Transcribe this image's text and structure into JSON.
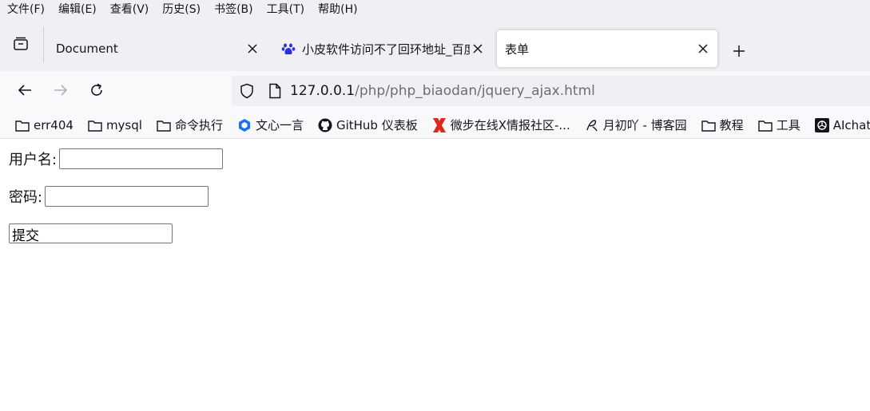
{
  "menubar": {
    "items": [
      {
        "label": "文件(F)"
      },
      {
        "label": "编辑(E)"
      },
      {
        "label": "查看(V)"
      },
      {
        "label": "历史(S)"
      },
      {
        "label": "书签(B)"
      },
      {
        "label": "工具(T)"
      },
      {
        "label": "帮助(H)"
      }
    ]
  },
  "tabs": [
    {
      "title": "Document",
      "favicon": "none",
      "active": false
    },
    {
      "title": "小皮软件访问不了回环地址_百度",
      "favicon": "baidu-paw-icon",
      "active": false
    },
    {
      "title": "表单",
      "favicon": "none",
      "active": true
    }
  ],
  "navbar": {
    "url_host": "127.0.0.1",
    "url_path": "/php/php_biaodan/jquery_ajax.html"
  },
  "bookmarks": [
    {
      "label": "err404",
      "icon": "folder-icon"
    },
    {
      "label": "mysql",
      "icon": "folder-icon"
    },
    {
      "label": "命令执行",
      "icon": "folder-icon"
    },
    {
      "label": "文心一言",
      "icon": "wenxin-icon"
    },
    {
      "label": "GitHub 仪表板",
      "icon": "github-icon"
    },
    {
      "label": "微步在线X情报社区-...",
      "icon": "threatbook-icon"
    },
    {
      "label": "月初吖 - 博客园",
      "icon": "cnblogs-icon"
    },
    {
      "label": "教程",
      "icon": "folder-icon"
    },
    {
      "label": "工具",
      "icon": "folder-icon"
    },
    {
      "label": "AIchatO",
      "icon": "openai-icon"
    }
  ],
  "form": {
    "username_label": "用户名:",
    "username_value": "",
    "password_label": "密码:",
    "password_value": "",
    "submit_label": "提交"
  },
  "colors": {
    "chrome_bg": "#f0f0f4",
    "toolbar_bg": "#f9f9fb",
    "active_tab_bg": "#ffffff",
    "baidu_blue": "#2932e1",
    "threatbook_red": "#e0271a"
  }
}
